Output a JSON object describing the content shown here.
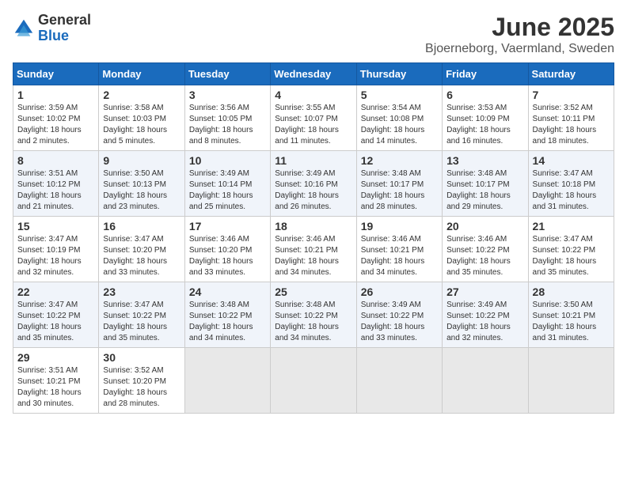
{
  "logo": {
    "general": "General",
    "blue": "Blue"
  },
  "title": "June 2025",
  "location": "Bjoerneborg, Vaermland, Sweden",
  "days_header": [
    "Sunday",
    "Monday",
    "Tuesday",
    "Wednesday",
    "Thursday",
    "Friday",
    "Saturday"
  ],
  "weeks": [
    [
      {
        "day": "1",
        "sunrise": "3:59 AM",
        "sunset": "10:02 PM",
        "daylight": "18 hours and 2 minutes."
      },
      {
        "day": "2",
        "sunrise": "3:58 AM",
        "sunset": "10:03 PM",
        "daylight": "18 hours and 5 minutes."
      },
      {
        "day": "3",
        "sunrise": "3:56 AM",
        "sunset": "10:05 PM",
        "daylight": "18 hours and 8 minutes."
      },
      {
        "day": "4",
        "sunrise": "3:55 AM",
        "sunset": "10:07 PM",
        "daylight": "18 hours and 11 minutes."
      },
      {
        "day": "5",
        "sunrise": "3:54 AM",
        "sunset": "10:08 PM",
        "daylight": "18 hours and 14 minutes."
      },
      {
        "day": "6",
        "sunrise": "3:53 AM",
        "sunset": "10:09 PM",
        "daylight": "18 hours and 16 minutes."
      },
      {
        "day": "7",
        "sunrise": "3:52 AM",
        "sunset": "10:11 PM",
        "daylight": "18 hours and 18 minutes."
      }
    ],
    [
      {
        "day": "8",
        "sunrise": "3:51 AM",
        "sunset": "10:12 PM",
        "daylight": "18 hours and 21 minutes."
      },
      {
        "day": "9",
        "sunrise": "3:50 AM",
        "sunset": "10:13 PM",
        "daylight": "18 hours and 23 minutes."
      },
      {
        "day": "10",
        "sunrise": "3:49 AM",
        "sunset": "10:14 PM",
        "daylight": "18 hours and 25 minutes."
      },
      {
        "day": "11",
        "sunrise": "3:49 AM",
        "sunset": "10:16 PM",
        "daylight": "18 hours and 26 minutes."
      },
      {
        "day": "12",
        "sunrise": "3:48 AM",
        "sunset": "10:17 PM",
        "daylight": "18 hours and 28 minutes."
      },
      {
        "day": "13",
        "sunrise": "3:48 AM",
        "sunset": "10:17 PM",
        "daylight": "18 hours and 29 minutes."
      },
      {
        "day": "14",
        "sunrise": "3:47 AM",
        "sunset": "10:18 PM",
        "daylight": "18 hours and 31 minutes."
      }
    ],
    [
      {
        "day": "15",
        "sunrise": "3:47 AM",
        "sunset": "10:19 PM",
        "daylight": "18 hours and 32 minutes."
      },
      {
        "day": "16",
        "sunrise": "3:47 AM",
        "sunset": "10:20 PM",
        "daylight": "18 hours and 33 minutes."
      },
      {
        "day": "17",
        "sunrise": "3:46 AM",
        "sunset": "10:20 PM",
        "daylight": "18 hours and 33 minutes."
      },
      {
        "day": "18",
        "sunrise": "3:46 AM",
        "sunset": "10:21 PM",
        "daylight": "18 hours and 34 minutes."
      },
      {
        "day": "19",
        "sunrise": "3:46 AM",
        "sunset": "10:21 PM",
        "daylight": "18 hours and 34 minutes."
      },
      {
        "day": "20",
        "sunrise": "3:46 AM",
        "sunset": "10:22 PM",
        "daylight": "18 hours and 35 minutes."
      },
      {
        "day": "21",
        "sunrise": "3:47 AM",
        "sunset": "10:22 PM",
        "daylight": "18 hours and 35 minutes."
      }
    ],
    [
      {
        "day": "22",
        "sunrise": "3:47 AM",
        "sunset": "10:22 PM",
        "daylight": "18 hours and 35 minutes."
      },
      {
        "day": "23",
        "sunrise": "3:47 AM",
        "sunset": "10:22 PM",
        "daylight": "18 hours and 35 minutes."
      },
      {
        "day": "24",
        "sunrise": "3:48 AM",
        "sunset": "10:22 PM",
        "daylight": "18 hours and 34 minutes."
      },
      {
        "day": "25",
        "sunrise": "3:48 AM",
        "sunset": "10:22 PM",
        "daylight": "18 hours and 34 minutes."
      },
      {
        "day": "26",
        "sunrise": "3:49 AM",
        "sunset": "10:22 PM",
        "daylight": "18 hours and 33 minutes."
      },
      {
        "day": "27",
        "sunrise": "3:49 AM",
        "sunset": "10:22 PM",
        "daylight": "18 hours and 32 minutes."
      },
      {
        "day": "28",
        "sunrise": "3:50 AM",
        "sunset": "10:21 PM",
        "daylight": "18 hours and 31 minutes."
      }
    ],
    [
      {
        "day": "29",
        "sunrise": "3:51 AM",
        "sunset": "10:21 PM",
        "daylight": "18 hours and 30 minutes."
      },
      {
        "day": "30",
        "sunrise": "3:52 AM",
        "sunset": "10:20 PM",
        "daylight": "18 hours and 28 minutes."
      },
      null,
      null,
      null,
      null,
      null
    ]
  ],
  "labels": {
    "sunrise": "Sunrise:",
    "sunset": "Sunset:",
    "daylight": "Daylight:"
  }
}
